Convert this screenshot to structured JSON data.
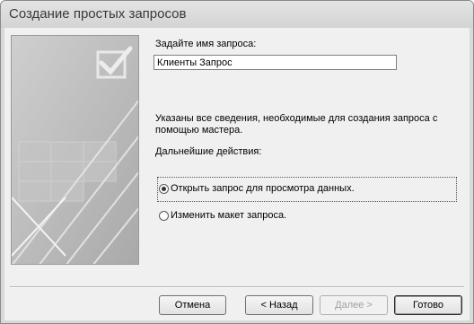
{
  "window": {
    "title": "Создание простых запросов"
  },
  "form": {
    "name_label": "Задайте имя запроса:",
    "name_value": "Клиенты Запрос",
    "info_text": "Указаны все сведения, необходимые для создания запроса с помощью мастера.",
    "next_actions_label": "Дальнейшие действия:"
  },
  "options": [
    {
      "label": "Открыть запрос для просмотра данных.",
      "checked": true
    },
    {
      "label": "Изменить макет запроса.",
      "checked": false
    }
  ],
  "buttons": {
    "cancel": "Отмена",
    "back": "< Назад",
    "next": "Далее >",
    "finish": "Готово"
  },
  "icons": {
    "wizard_art": "wizard-illustration-icon",
    "checkbox": "checkmark-box-icon"
  }
}
